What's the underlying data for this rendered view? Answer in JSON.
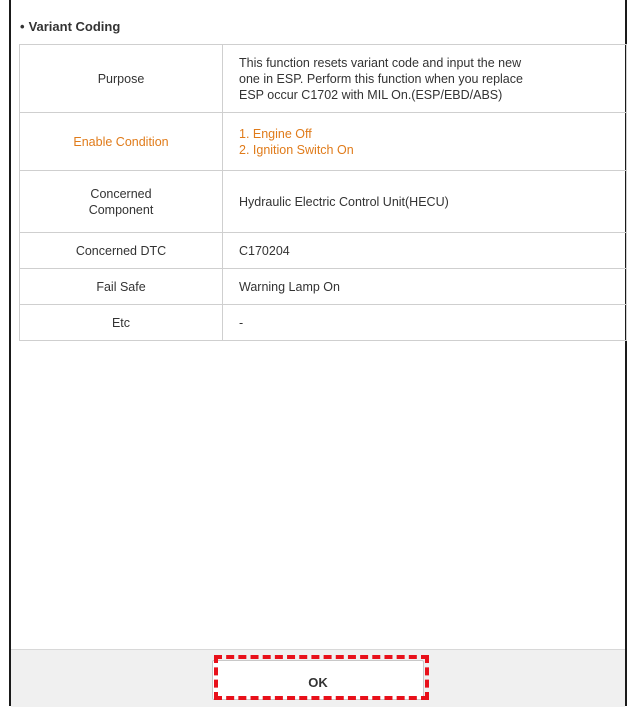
{
  "section": {
    "bullet": "•",
    "title": "Variant Coding"
  },
  "table": {
    "rows": [
      {
        "label": "Purpose",
        "lines": [
          "This function resets variant code and input the new",
          "one in ESP. Perform this function when you replace",
          "ESP occur C1702 with MIL On.(ESP/EBD/ABS)"
        ]
      },
      {
        "label": "Enable Condition",
        "lines": [
          "1. Engine Off",
          "2. Ignition Switch On"
        ]
      },
      {
        "label": [
          "Concerned",
          "Component"
        ],
        "lines": [
          "Hydraulic Electric Control Unit(HECU)"
        ]
      },
      {
        "label": "Concerned DTC",
        "lines": [
          "C170204"
        ]
      },
      {
        "label": "Fail Safe",
        "lines": [
          "Warning Lamp On"
        ]
      },
      {
        "label": "Etc",
        "lines": [
          "-"
        ]
      }
    ]
  },
  "footer": {
    "ok_label": "OK"
  },
  "colors": {
    "highlight_text": "#e07b1a",
    "annotation_dash": "#e8101a"
  }
}
